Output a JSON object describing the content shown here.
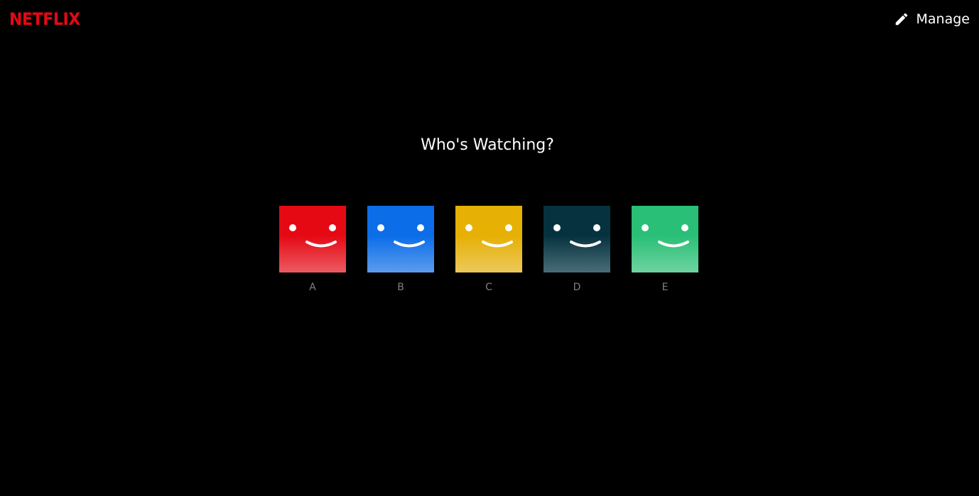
{
  "header": {
    "logo": "NETFLIX",
    "manage_label": "Manage",
    "manage_icon": "pencil-icon"
  },
  "title": "Who's Watching?",
  "profiles": [
    {
      "name": "A",
      "color_top": "#e50914",
      "color_bottom": "#ec5a62",
      "icon": "smiley-avatar-icon"
    },
    {
      "name": "B",
      "color_top": "#0b6de8",
      "color_bottom": "#5b9cee",
      "icon": "smiley-avatar-icon"
    },
    {
      "name": "C",
      "color_top": "#e6b005",
      "color_bottom": "#ecc85a",
      "icon": "smiley-avatar-icon"
    },
    {
      "name": "D",
      "color_top": "#06323f",
      "color_bottom": "#496d77",
      "icon": "smiley-avatar-icon"
    },
    {
      "name": "E",
      "color_top": "#29bf76",
      "color_bottom": "#6fd3a1",
      "icon": "smiley-avatar-icon"
    }
  ],
  "colors": {
    "brand": "#e50914",
    "background": "#000000",
    "profile_name": "#808080"
  }
}
